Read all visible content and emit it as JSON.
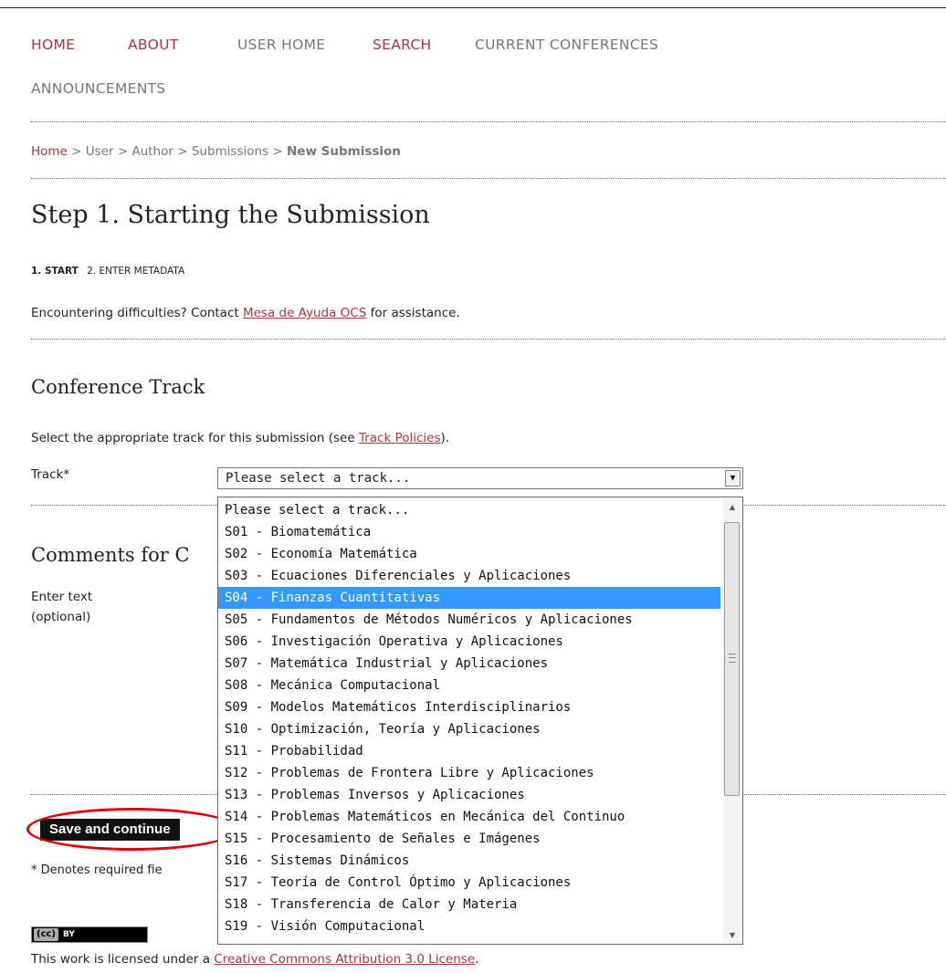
{
  "nav": {
    "items": [
      "HOME",
      "ABOUT",
      "USER HOME",
      "SEARCH",
      "CURRENT CONFERENCES",
      "ANNOUNCEMENTS"
    ]
  },
  "breadcrumb": {
    "home": "Home",
    "sep": ">",
    "user": "User",
    "author": "Author",
    "submissions": "Submissions",
    "current": "New Submission"
  },
  "page": {
    "title": "Step 1. Starting the Submission",
    "steps": {
      "step1": "1. START",
      "step2": "2. ENTER METADATA"
    },
    "help_prefix": "Encountering difficulties? Contact ",
    "help_link": "Mesa de Ayuda OCS",
    "help_suffix": " for assistance."
  },
  "track_section": {
    "heading": "Conference Track",
    "instruction_prefix": "Select the appropriate track for this submission (see ",
    "instruction_link": "Track Policies",
    "instruction_suffix": ").",
    "label": "Track*",
    "selected_value": "Please select a track...",
    "highlighted_index": 4,
    "options": [
      "Please select a track...",
      "S01 - Biomatemática",
      "S02 - Economía Matemática",
      "S03 - Ecuaciones Diferenciales y Aplicaciones",
      "S04 - Finanzas Cuantitativas",
      "S05 - Fundamentos de Métodos Numéricos y Aplicaciones",
      "S06 - Investigación Operativa y Aplicaciones",
      "S07 - Matemática Industrial y Aplicaciones",
      "S08 - Mecánica Computacional",
      "S09 - Modelos Matemáticos Interdisciplinarios",
      "S10 - Optimización, Teoría y Aplicaciones",
      "S11 - Probabilidad",
      "S12 - Problemas de Frontera Libre y Aplicaciones",
      "S13 - Problemas Inversos y Aplicaciones",
      "S14 - Problemas Matemáticos en Mecánica del Continuo",
      "S15 - Procesamiento de Señales e Imágenes",
      "S16 - Sistemas Dinámicos",
      "S17 - Teoría de Control Óptimo y Aplicaciones",
      "S18 - Transferencia de Calor y Materia",
      "S19 - Visión Computacional"
    ]
  },
  "comments_section": {
    "heading": "Comments for C",
    "label_line1": "Enter text",
    "label_line2": "(optional)"
  },
  "actions": {
    "save_label": "Save and continue"
  },
  "footer": {
    "required_note": "* Denotes required fie",
    "cc_badge": "(cc)",
    "by_badge": "BY",
    "license_prefix": "This work is licensed under a ",
    "license_link": "Creative Commons Attribution 3.0 License",
    "license_suffix": "."
  },
  "colors": {
    "link_red": "#b0353a",
    "nav_grey": "#777777",
    "highlight_blue": "#3399ff",
    "annotation_red": "#e00000"
  }
}
